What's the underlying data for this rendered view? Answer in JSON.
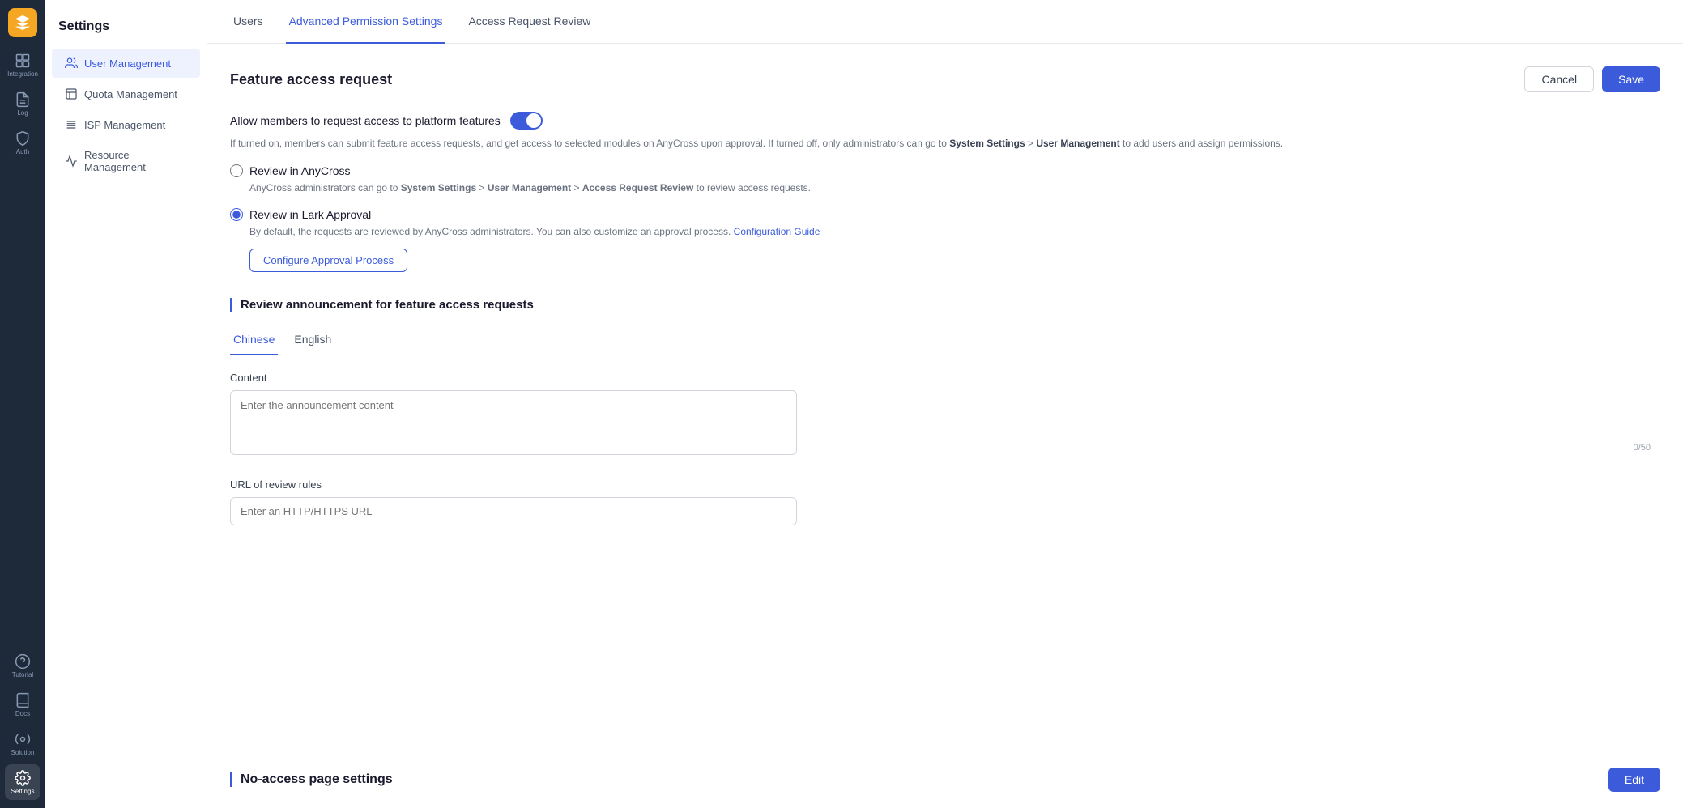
{
  "nav": {
    "logo_alt": "AnyCross Logo",
    "items": [
      {
        "id": "integration",
        "label": "Integration",
        "active": false
      },
      {
        "id": "log",
        "label": "Log",
        "active": false
      },
      {
        "id": "auth",
        "label": "Auth",
        "active": false
      },
      {
        "id": "tutorial",
        "label": "Tutorial",
        "active": false
      },
      {
        "id": "docs",
        "label": "Docs",
        "active": false
      },
      {
        "id": "solution",
        "label": "Solution",
        "active": false
      },
      {
        "id": "settings",
        "label": "Settings",
        "active": true
      }
    ]
  },
  "sidebar": {
    "title": "Settings",
    "items": [
      {
        "id": "user-management",
        "label": "User Management",
        "active": true
      },
      {
        "id": "quota-management",
        "label": "Quota Management",
        "active": false
      },
      {
        "id": "isp-management",
        "label": "ISP Management",
        "active": false
      },
      {
        "id": "resource-management",
        "label": "Resource Management",
        "active": false
      }
    ]
  },
  "tabs": [
    {
      "id": "users",
      "label": "Users",
      "active": false
    },
    {
      "id": "advanced-permission",
      "label": "Advanced Permission Settings",
      "active": true
    },
    {
      "id": "access-request-review",
      "label": "Access Request Review",
      "active": false
    }
  ],
  "header_actions": {
    "cancel_label": "Cancel",
    "save_label": "Save"
  },
  "feature_access": {
    "section_title": "Feature access request",
    "toggle_label": "Allow members to request access to platform features",
    "toggle_on": true,
    "description": "If turned on, members can submit feature access requests, and get access to selected modules on AnyCross upon approval. If turned off, only administrators can go to System Settings > User Management to add users and assign permissions.",
    "description_bold1": "System Settings",
    "description_bold2": "User Management",
    "review_options": [
      {
        "id": "review-anycross",
        "label": "Review in AnyCross",
        "selected": false,
        "description": "AnyCross administrators can go to System Settings > User Management > Access Request Review to review access requests.",
        "desc_bold1": "System Settings",
        "desc_bold2": "User Management",
        "desc_bold3": "Access Request Review"
      },
      {
        "id": "review-lark",
        "label": "Review in Lark Approval",
        "selected": true,
        "description": "By default, the requests are reviewed by AnyCross administrators. You can also customize an approval process.",
        "link_text": "Configuration Guide",
        "configure_btn": "Configure Approval Process"
      }
    ]
  },
  "announcement": {
    "section_title": "Review announcement for feature access requests",
    "lang_tabs": [
      {
        "id": "chinese",
        "label": "Chinese",
        "active": true
      },
      {
        "id": "english",
        "label": "English",
        "active": false
      }
    ],
    "content_label": "Content",
    "content_placeholder": "Enter the announcement content",
    "content_value": "",
    "char_count": "0/50",
    "url_label": "URL of review rules",
    "url_placeholder": "Enter an HTTP/HTTPS URL",
    "url_value": ""
  },
  "no_access": {
    "section_title": "No-access page settings",
    "edit_label": "Edit"
  }
}
